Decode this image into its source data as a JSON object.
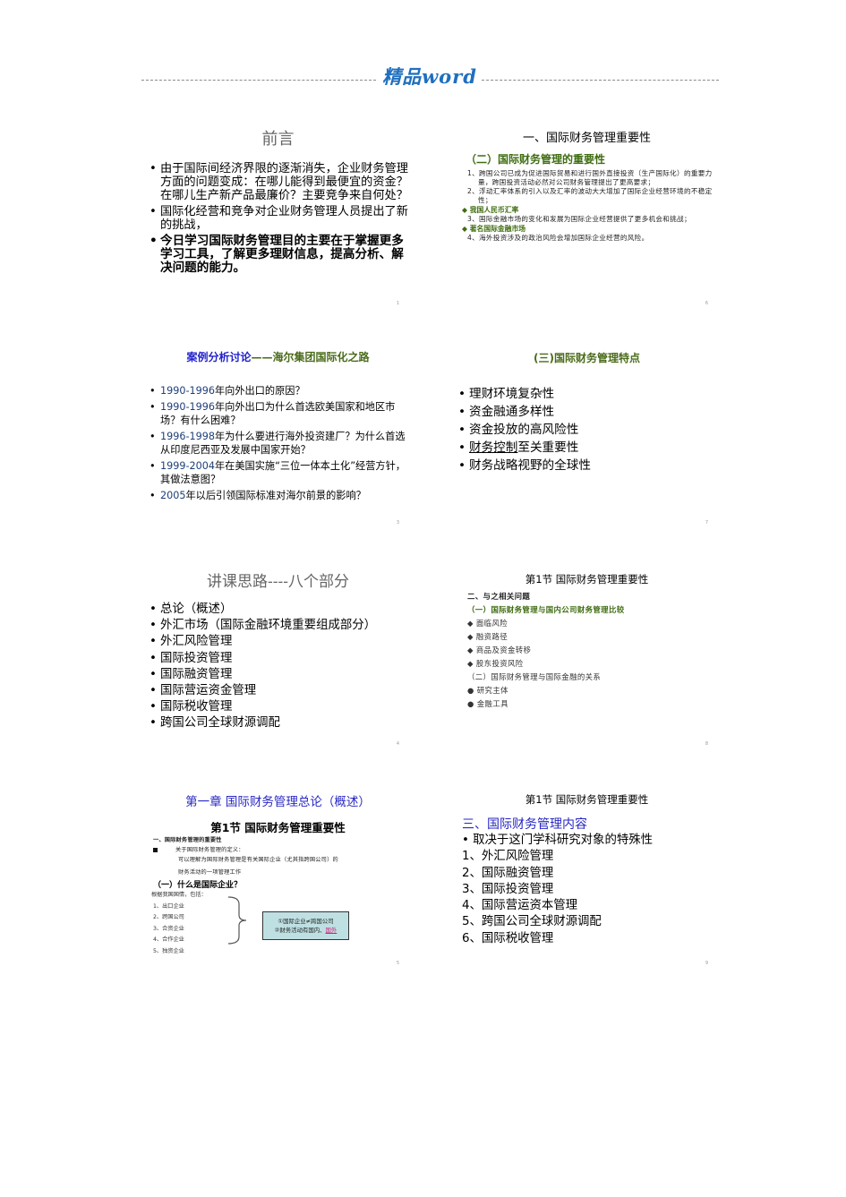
{
  "header": {
    "title": "精品word"
  },
  "slides": {
    "s1": {
      "title": "前言",
      "items": [
        "由于国际间经济界限的逐渐消失，企业财务管理方面的问题变成：在哪儿能得到最便宜的资金？在哪儿生产新产品最廉价？主要竞争来自何处？",
        "国际化经营和竞争对企业财务管理人员提出了新的挑战，",
        "今日学习国际财务管理目的主要在于掌握更多学习工具，了解更多理财信息，提高分析、解决问题的能力。"
      ],
      "page": "1"
    },
    "s6": {
      "title": "一、国际财务管理重要性",
      "subtitle": "（二）国际财务管理的重要性",
      "p1": "1、跨国公司已成为促进国际贸易和进行国外直接投资（生产国际化）的重要力量，跨国投资活动必然对公司财务管理提出了更高要求；",
      "p2": "2、浮动汇率体系的引入以及汇率的波动大大增加了国际企业经营环境的不稳定性；",
      "d1": "◆ 我国人民币汇率",
      "p3": "3、国际金融市场的变化和发展为国际企业经营提供了更多机会和挑战；",
      "d2": "◆ 著名国际金融市场",
      "p4": "4、海外投资涉及的政治风险会增加国际企业经营的风险。",
      "page": "6"
    },
    "s3": {
      "title_blue": "案例分析讨论",
      "title_green": "——海尔集团国际化之路",
      "items": [
        {
          "year": "1990-1996",
          "text": "年向外出口的原因？"
        },
        {
          "year": "1990-1996",
          "text": "年向外出口为什么首选欧美国家和地区市场？有什么困难？"
        },
        {
          "year": "1996-1998",
          "text": "年为什么要进行海外投资建厂？为什么首选从印度尼西亚及发展中国家开始？"
        },
        {
          "year": "1999-2004",
          "text": "年在美国实施“三位一体本土化”经营方针，其做法意图？"
        },
        {
          "year": "2005",
          "text": "年以后引领国际标准对海尔前景的影响？"
        }
      ],
      "page": "3"
    },
    "s7": {
      "title": "(三)国际财务管理特点",
      "items": [
        "理财环境复杂性",
        "资金融通多样性",
        "资金投放的高风险性",
        "财务控制",
        "至关重要性",
        "财务战略视野的全球性"
      ],
      "page": "7"
    },
    "s4": {
      "title": "讲课思路----八个部分",
      "items": [
        "总论（概述）",
        "外汇市场（国际金融环境重要组成部分）",
        "外汇风险管理",
        "国际投资管理",
        "国际融资管理",
        "国际营运资金管理",
        "国际税收管理",
        "跨国公司全球财源调配"
      ],
      "page": "4"
    },
    "s8": {
      "title": "第1节  国际财务管理重要性",
      "h2": "二、与之相关问题",
      "g1": "（一）国际财务管理与国内公司财务管理比较",
      "d": [
        "◆ 面临风险",
        "◆ 融资路径",
        "◆ 商品及资金转移",
        "◆ 股东投资风险"
      ],
      "g2": "（二）国际财务管理与国际金融的关系",
      "c": [
        "● 研究主体",
        "● 金融工具"
      ],
      "page": "8"
    },
    "s5": {
      "chapter": "第一章  国际财务管理总论（概述）",
      "section": "第1节 国际财务管理重要性",
      "h1": "一、国际财务管理的重要性",
      "def_label": "关于国际财务管理的定义：",
      "def1": "可以理解为国际财务管理是有关国际企业（尤其指跨国公司）的",
      "def2": "财务活动的一项管理工作",
      "q": "（一）什么是国际企业？",
      "intro": "根据我国国情，包括：",
      "list": [
        "1、出口企业",
        "2、跨国公司",
        "3、合资企业",
        "4、合作企业",
        "5、独资企业"
      ],
      "callout1": "①国际企业≠跨国公司",
      "callout2a": "②财务活动有国内、",
      "callout2b": "国外",
      "page": "5"
    },
    "s9": {
      "title": "第1节  国际财务管理重要性",
      "heading": "三、国际财务管理内容",
      "bullet": "取决于这门学科研究对象的特殊性",
      "items": [
        "1、外汇风险管理",
        "2、国际融资管理",
        "3、国际投资管理",
        "4、国际营运资本管理",
        "5、跨国公司全球财源调配",
        "6、国际税收管理"
      ],
      "page": "9"
    }
  }
}
